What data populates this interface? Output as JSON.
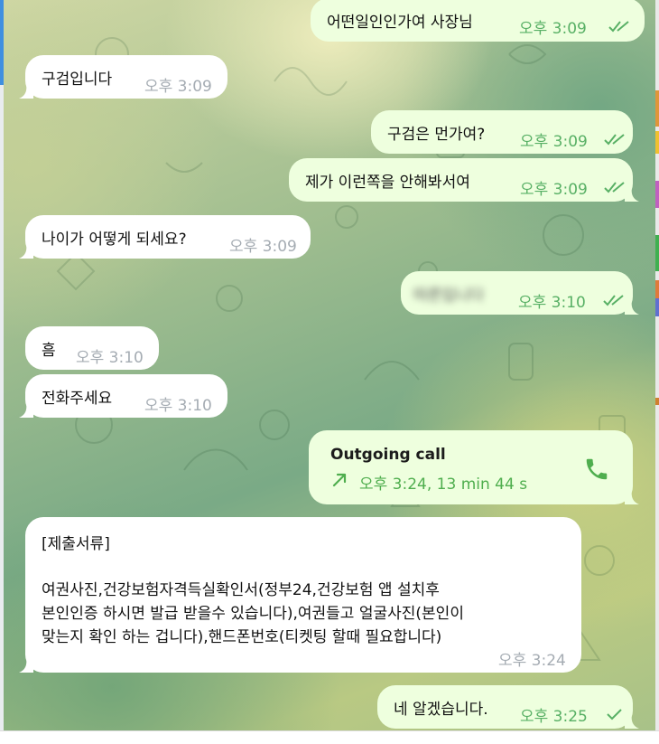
{
  "chat": {
    "messages": [
      {
        "id": "m1",
        "dir": "out",
        "text": "어떤일인인가여 사장님",
        "time": "오후 3:09",
        "status": "read"
      },
      {
        "id": "m2",
        "dir": "in",
        "text": "구검입니다",
        "time": "오후 3:09"
      },
      {
        "id": "m3",
        "dir": "out",
        "text": "구검은 먼가여?",
        "time": "오후 3:09",
        "status": "read"
      },
      {
        "id": "m4",
        "dir": "out",
        "text": "제가 이런쪽을 안해봐서여",
        "time": "오후 3:09",
        "status": "read"
      },
      {
        "id": "m5",
        "dir": "in",
        "text": "나이가 어떻게 되세요?",
        "time": "오후 3:09"
      },
      {
        "id": "m6",
        "dir": "out",
        "text": "따른입니다",
        "time": "오후 3:10",
        "status": "read",
        "blurred": true
      },
      {
        "id": "m7",
        "dir": "in",
        "text": "흠",
        "time": "오후 3:10"
      },
      {
        "id": "m8",
        "dir": "in",
        "text": "전화주세요",
        "time": "오후 3:10"
      },
      {
        "id": "m10",
        "dir": "in",
        "time": "오후 3:24",
        "lines": [
          "[제출서류]",
          "",
          "여권사진,건강보험자격득실확인서(정부24,건강보험 앱 설치후",
          "본인인증 하시면 발급 받을수 있습니다),여권들고 얼굴사진(본인이",
          "맞는지 확인 하는 겁니다),핸드폰번호(티켓팅 할때 필요합니다)"
        ]
      },
      {
        "id": "m11",
        "dir": "out",
        "text": "네 알겠습니다.",
        "time": "오후 3:25",
        "status": "sent"
      }
    ],
    "call": {
      "title": "Outgoing call",
      "time": "오후 3:24, 13 min 44 s",
      "icon": "phone-icon",
      "direction_icon": "outgoing-arrow-icon"
    }
  },
  "colors": {
    "outgoing_bubble": "#eeffde",
    "incoming_bubble": "#ffffff",
    "accent_green": "#4fae4e",
    "time_gray": "#a5acb3"
  }
}
